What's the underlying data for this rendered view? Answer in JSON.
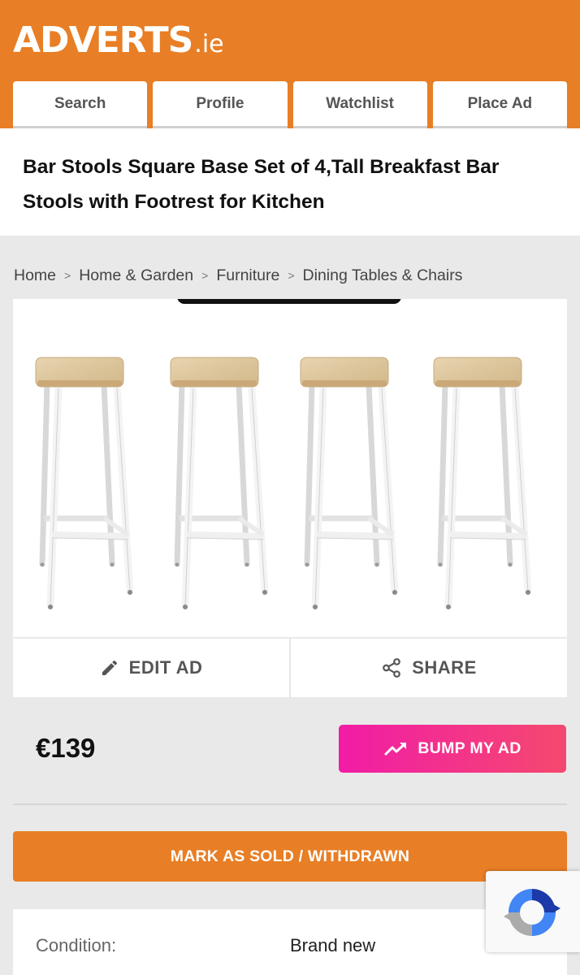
{
  "brand": {
    "logo_text": "ADVERTS",
    "logo_tld": ".ie",
    "accent_color": "#e87e25"
  },
  "nav": {
    "tabs": [
      {
        "label": "Search"
      },
      {
        "label": "Profile"
      },
      {
        "label": "Watchlist"
      },
      {
        "label": "Place Ad"
      }
    ]
  },
  "listing": {
    "title": "Bar Stools Square Base Set of 4,Tall Breakfast Bar Stools with Footrest for Kitchen",
    "price": "€139"
  },
  "breadcrumb": [
    {
      "label": "Home"
    },
    {
      "label": "Home & Garden"
    },
    {
      "label": "Furniture"
    },
    {
      "label": "Dining Tables & Chairs"
    }
  ],
  "photo": {
    "subject_icon": "bar-stool",
    "count": 4
  },
  "actions": {
    "edit": {
      "label": "EDIT AD",
      "icon": "pencil-icon"
    },
    "share": {
      "label": "SHARE",
      "icon": "share-icon"
    },
    "bump": {
      "label": "BUMP MY AD",
      "icon": "trending-up-icon",
      "gradient": [
        "#f11ca6",
        "#f5496f"
      ]
    },
    "mark_sold": {
      "label": "MARK AS SOLD / WITHDRAWN"
    }
  },
  "details": {
    "rows": [
      {
        "label": "Condition:",
        "value": "Brand new"
      }
    ]
  },
  "recaptcha": {
    "icon": "recaptcha-icon"
  }
}
